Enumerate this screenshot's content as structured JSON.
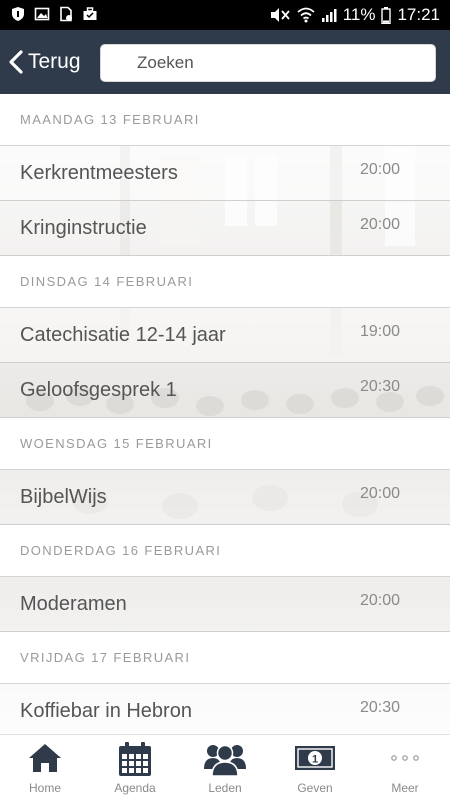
{
  "statusbar": {
    "battery": "11%",
    "time": "17:21",
    "icons": [
      "shield-icon",
      "image-icon",
      "sim-icon",
      "briefcase-icon",
      "mute-icon",
      "wifi-icon",
      "signal-icon",
      "battery-icon"
    ]
  },
  "topbar": {
    "back_label": "Terug",
    "search_placeholder": "Zoeken",
    "background": "#2f3b4a"
  },
  "agenda": [
    {
      "day": "MAANDAG 13 FEBRUARI",
      "events": [
        {
          "title": "Kerkrentmeesters",
          "time": "20:00"
        },
        {
          "title": "Kringinstructie",
          "time": "20:00"
        }
      ]
    },
    {
      "day": "DINSDAG 14 FEBRUARI",
      "events": [
        {
          "title": "Catechisatie 12-14 jaar",
          "time": "19:00"
        },
        {
          "title": "Geloofsgesprek 1",
          "time": "20:30"
        }
      ]
    },
    {
      "day": "WOENSDAG 15 FEBRUARI",
      "events": [
        {
          "title": "BijbelWijs",
          "time": "20:00"
        }
      ]
    },
    {
      "day": "DONDERDAG 16 FEBRUARI",
      "events": [
        {
          "title": "Moderamen",
          "time": "20:00"
        }
      ]
    },
    {
      "day": "VRIJDAG 17 FEBRUARI",
      "events": [
        {
          "title": "Koffiebar in Hebron",
          "time": "20:30"
        }
      ]
    }
  ],
  "tabs": [
    {
      "label": "Home",
      "icon": "home-icon"
    },
    {
      "label": "Agenda",
      "icon": "calendar-icon"
    },
    {
      "label": "Leden",
      "icon": "members-icon"
    },
    {
      "label": "Geven",
      "icon": "banknote-icon"
    },
    {
      "label": "Meer",
      "icon": "more-icon"
    }
  ],
  "colors": {
    "accent": "#2f3b4a",
    "icon": "#2f3b4a",
    "muted_text": "#9a9a9a"
  }
}
